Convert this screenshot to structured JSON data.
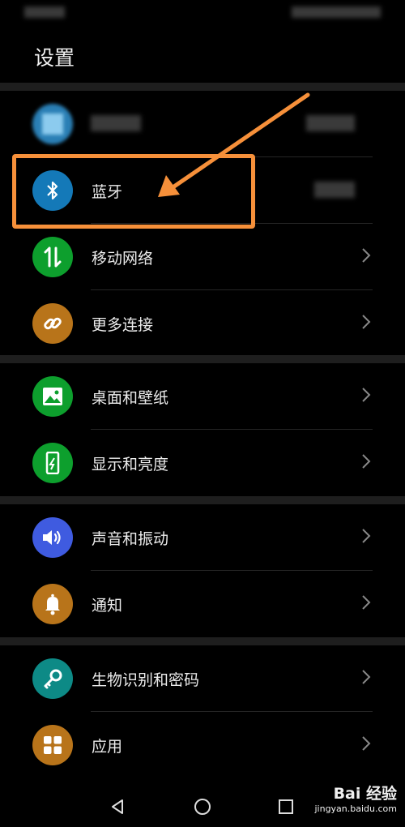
{
  "page": {
    "title": "设置"
  },
  "items": [
    {
      "id": "bluetooth",
      "label": "蓝牙",
      "icon": "bluetooth-icon",
      "color": "#1479b8"
    },
    {
      "id": "mobile-network",
      "label": "移动网络",
      "icon": "mobile-data-icon",
      "color": "#0d9f2d"
    },
    {
      "id": "more-connections",
      "label": "更多连接",
      "icon": "link-icon",
      "color": "#b8741a"
    },
    {
      "id": "wallpaper",
      "label": "桌面和壁纸",
      "icon": "image-icon",
      "color": "#0d9f2d"
    },
    {
      "id": "display",
      "label": "显示和亮度",
      "icon": "phone-brightness-icon",
      "color": "#0d9f2d"
    },
    {
      "id": "sound",
      "label": "声音和振动",
      "icon": "speaker-icon",
      "color": "#3f5be0"
    },
    {
      "id": "notifications",
      "label": "通知",
      "icon": "bell-icon",
      "color": "#b8741a"
    },
    {
      "id": "biometrics",
      "label": "生物识别和密码",
      "icon": "key-icon",
      "color": "#0d8a86"
    },
    {
      "id": "apps",
      "label": "应用",
      "icon": "grid-icon",
      "color": "#b8741a"
    }
  ],
  "watermark": {
    "main": "Bai 经验",
    "sub": "jingyan.baidu.com"
  }
}
